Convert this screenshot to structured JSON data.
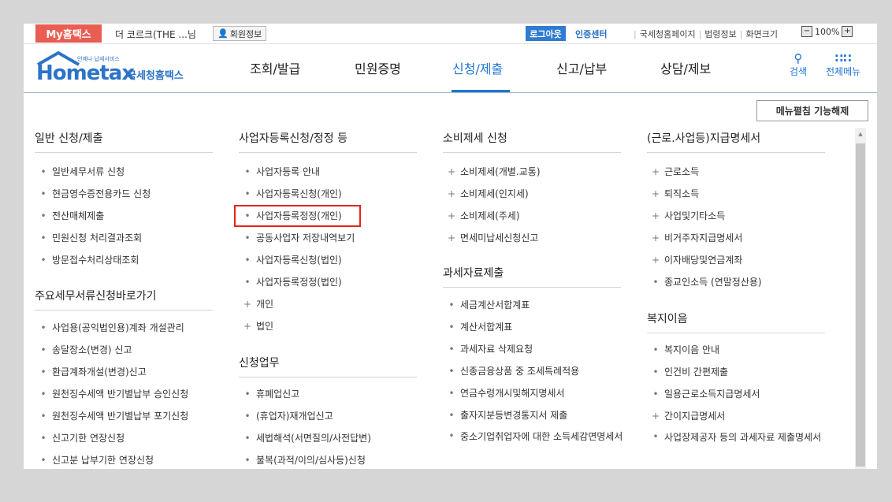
{
  "topbar": {
    "mytax": "My홈택스",
    "company": "더 코르크(THE ...님",
    "member_info": "회원정보",
    "logout": "로그아웃",
    "cert_center": "인증센터",
    "links": [
      "국세청홈페이지",
      "법령정보",
      "화면크기"
    ],
    "zoom_minus": "−",
    "zoom_value": "100%",
    "zoom_plus": "+"
  },
  "logo": {
    "small": "언제나 납세서비스",
    "main": "Hometax",
    "sub": "국세청홈택스"
  },
  "nav": [
    "조회/발급",
    "민원증명",
    "신청/제출",
    "신고/납부",
    "상담/제보"
  ],
  "nav_active": "신청/제출",
  "header_buttons": {
    "search": "검색",
    "all_menu": "전체메뉴"
  },
  "unfold_button": "메뉴펼침 기능해제",
  "columns": [
    {
      "sections": [
        {
          "title": "일반 신청/제출",
          "items": [
            "일반세무서류 신청",
            "현금영수증전용카드 신청",
            "전산매체제출",
            "민원신청 처리결과조회",
            "방문접수처리상태조회"
          ]
        },
        {
          "title": "주요세무서류신청바로가기",
          "items": [
            "사업용(공익법인용)계좌 개설관리",
            "송달장소(변경) 신고",
            "환급계좌개설(변경)신고",
            "원천징수세액 반기별납부 승인신청",
            "원천징수세액 반기별납부 포기신청",
            "신고기한 연장신청",
            "신고분 납부기한 연장신청"
          ]
        }
      ]
    },
    {
      "sections": [
        {
          "title": "사업자등록신청/정정 등",
          "items": [
            "사업자등록 안내",
            "사업자등록신청(개인)",
            "사업자등록정정(개인)",
            "공동사업자 저장내역보기",
            "사업자등록신청(법인)",
            "사업자등록정정(법인)",
            "개인",
            "법인"
          ]
        },
        {
          "title": "신청업무",
          "items": [
            "휴폐업신고",
            "(휴업자)재개업신고",
            "세법해석(서면질의/사전답변)",
            "불복(과적/이의/심사등)신청"
          ]
        }
      ]
    },
    {
      "sections": [
        {
          "title": "소비제세 신청",
          "items": [
            "소비제세(개별.교통)",
            "소비제세(인지세)",
            "소비제세(주세)",
            "면세미납세신청신고"
          ]
        },
        {
          "title": "과세자료제출",
          "items": [
            "세금계산서합계표",
            "계산서합계표",
            "과세자료 삭제요청",
            "신종금융상품 중 조세특례적용",
            "연금수령개시및해지명세서",
            "출자지분등변경통지서 제출",
            "중소기업취업자에 대한 소득세감면명세서"
          ]
        }
      ]
    },
    {
      "sections": [
        {
          "title": "(근로.사업등)지급명세서",
          "items": [
            "근로소득",
            "퇴직소득",
            "사업및기타소득",
            "비거주자지급명세서",
            "이자배당및연금계좌",
            "종교인소득 (연말정산용)"
          ]
        },
        {
          "title": "복지이음",
          "items": [
            "복지이음 안내",
            "인건비 간편제출",
            "일용근로소득지급명세서",
            "간이지급명세서",
            "사업장제공자 등의 과세자료 제출명세서"
          ]
        }
      ]
    }
  ],
  "highlighted_item": "사업자등록정정(개인)"
}
